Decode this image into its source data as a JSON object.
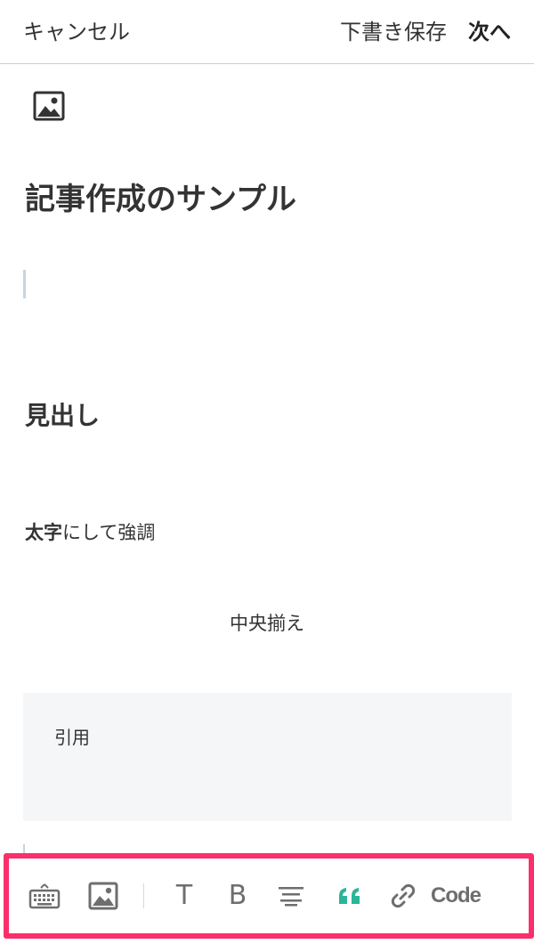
{
  "header": {
    "cancel_label": "キャンセル",
    "save_draft_label": "下書き保存",
    "next_label": "次へ"
  },
  "editor": {
    "title": "記事作成のサンプル",
    "heading": "見出し",
    "paragraph_bold": "太字",
    "paragraph_rest": "にして強調",
    "centered_text": "中央揃え",
    "quote_text": "引用"
  },
  "toolbar": {
    "items": [
      "keyboard-icon",
      "image-icon",
      "text-icon",
      "bold-icon",
      "align-center-icon",
      "quote-icon",
      "link-icon",
      "code-button"
    ],
    "text_label": "T",
    "bold_label": "B",
    "code_label": "Code",
    "highlight_color": "#fa2f6b",
    "quote_color": "#2bb59a"
  }
}
